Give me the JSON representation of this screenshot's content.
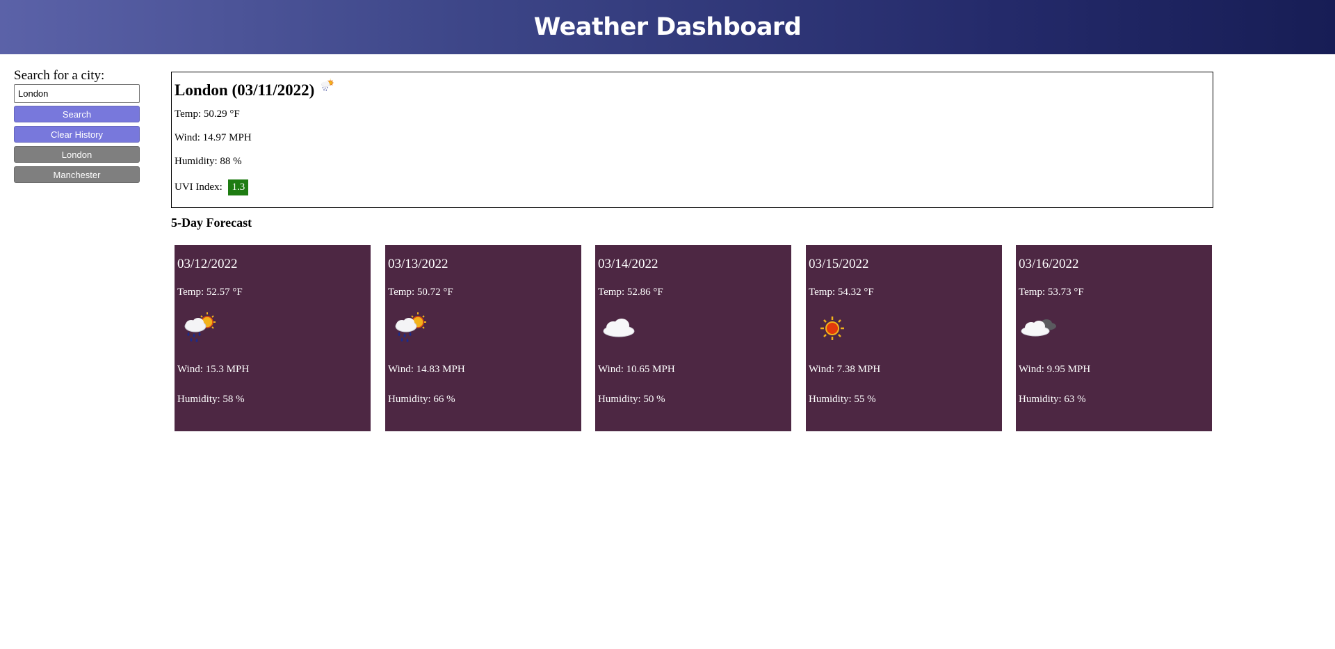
{
  "header": {
    "title": "Weather Dashboard"
  },
  "sidebar": {
    "search_label": "Search for a city:",
    "search_value": "London",
    "search_button": "Search",
    "clear_button": "Clear History",
    "history": [
      "London",
      "Manchester"
    ]
  },
  "current": {
    "title": "London (03/11/2022)",
    "icon": "rain-sun-icon",
    "temp": "Temp: 50.29 °F",
    "wind": "Wind: 14.97 MPH",
    "humidity": "Humidity: 88 %",
    "uvi_label": "UVI Index:",
    "uvi_value": "1.3",
    "uvi_color": "#1e7c12"
  },
  "forecast": {
    "title": "5-Day Forecast",
    "card_color": "#4d2743",
    "days": [
      {
        "date": "03/12/2022",
        "temp": "Temp: 52.57 °F",
        "icon": "rain-sun-icon",
        "wind": "Wind: 15.3 MPH",
        "humidity": "Humidity: 58 %"
      },
      {
        "date": "03/13/2022",
        "temp": "Temp: 50.72 °F",
        "icon": "rain-sun-icon",
        "wind": "Wind: 14.83 MPH",
        "humidity": "Humidity: 66 %"
      },
      {
        "date": "03/14/2022",
        "temp": "Temp: 52.86 °F",
        "icon": "cloud-icon",
        "wind": "Wind: 10.65 MPH",
        "humidity": "Humidity: 50 %"
      },
      {
        "date": "03/15/2022",
        "temp": "Temp: 54.32 °F",
        "icon": "sun-icon",
        "wind": "Wind: 7.38 MPH",
        "humidity": "Humidity: 55 %"
      },
      {
        "date": "03/16/2022",
        "temp": "Temp: 53.73 °F",
        "icon": "broken-clouds-icon",
        "wind": "Wind: 9.95 MPH",
        "humidity": "Humidity: 63 %"
      }
    ]
  },
  "colors": {
    "header_start": "#5b62a8",
    "header_end": "#171d55",
    "primary_button": "#7878dc",
    "history_button": "#7f7f7f"
  }
}
